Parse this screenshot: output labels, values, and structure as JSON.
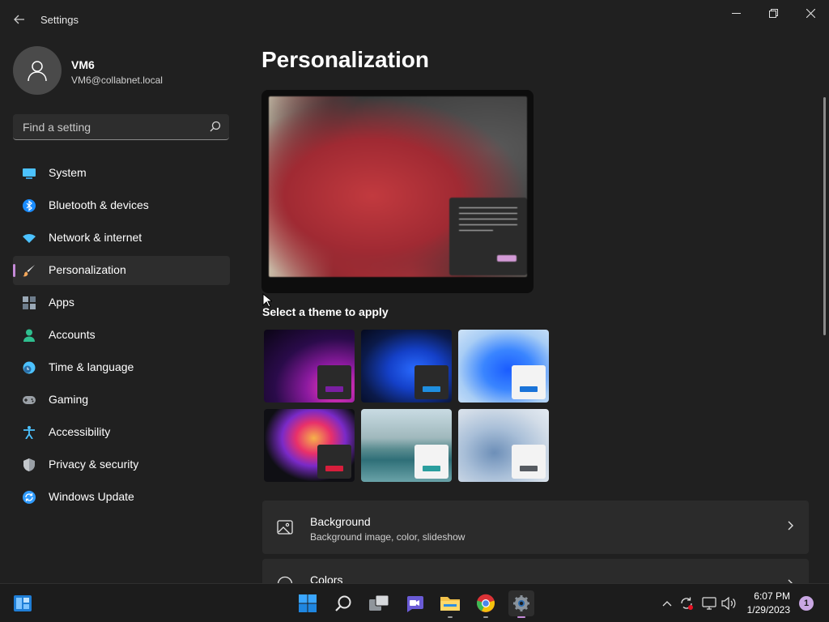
{
  "window": {
    "title": "Settings",
    "back_icon": "back-arrow-icon",
    "controls": [
      "minimize-icon",
      "restore-icon",
      "close-icon"
    ]
  },
  "profile": {
    "name": "VM6",
    "email": "VM6@collabnet.local"
  },
  "search": {
    "placeholder": "Find a setting",
    "icon": "search-icon"
  },
  "nav": {
    "selected_index": 3,
    "accent": "#c58ad8",
    "items": [
      {
        "label": "System",
        "icon": "monitor-icon",
        "color": "#4cc2ff"
      },
      {
        "label": "Bluetooth & devices",
        "icon": "bluetooth-icon",
        "color": "#1a8cff"
      },
      {
        "label": "Network & internet",
        "icon": "wifi-icon",
        "color": "#4cc2ff"
      },
      {
        "label": "Personalization",
        "icon": "brush-icon",
        "color": "#f2a65a"
      },
      {
        "label": "Apps",
        "icon": "apps-icon",
        "color": "#9aa8b6"
      },
      {
        "label": "Accounts",
        "icon": "person-icon",
        "color": "#2fbf8f"
      },
      {
        "label": "Time & language",
        "icon": "clock-globe-icon",
        "color": "#4cc2ff"
      },
      {
        "label": "Gaming",
        "icon": "gamepad-icon",
        "color": "#9aa0a6"
      },
      {
        "label": "Accessibility",
        "icon": "accessibility-icon",
        "color": "#4cc2ff"
      },
      {
        "label": "Privacy & security",
        "icon": "shield-icon",
        "color": "#9aa0a6"
      },
      {
        "label": "Windows Update",
        "icon": "update-icon",
        "color": "#2f9bff"
      }
    ]
  },
  "main": {
    "title": "Personalization",
    "theme_section_label": "Select a theme to apply",
    "themes": [
      {
        "name": "theme-glow",
        "accent": "#7a1fa2"
      },
      {
        "name": "theme-windows-dark",
        "accent": "#1f8fe0"
      },
      {
        "name": "theme-windows-light",
        "accent": "#1a73d8"
      },
      {
        "name": "theme-captured-motion",
        "accent": "#d81e3c"
      },
      {
        "name": "theme-flow",
        "accent": "#2a9e9e"
      },
      {
        "name": "theme-sunrise",
        "accent": "#555a60"
      }
    ],
    "cards": [
      {
        "title": "Background",
        "subtitle": "Background image, color, slideshow",
        "icon": "picture-icon"
      },
      {
        "title": "Colors",
        "subtitle": "",
        "icon": "palette-icon"
      }
    ]
  },
  "taskbar": {
    "apps": [
      "widgets-icon",
      "start-icon",
      "search-icon",
      "task-view-icon",
      "teams-chat-icon",
      "file-explorer-icon",
      "chrome-icon",
      "settings-icon"
    ],
    "tray": [
      "chevron-up-icon",
      "sync-icon",
      "network-icon",
      "volume-icon"
    ],
    "time": "6:07 PM",
    "date": "1/29/2023",
    "notification_count": "1"
  }
}
